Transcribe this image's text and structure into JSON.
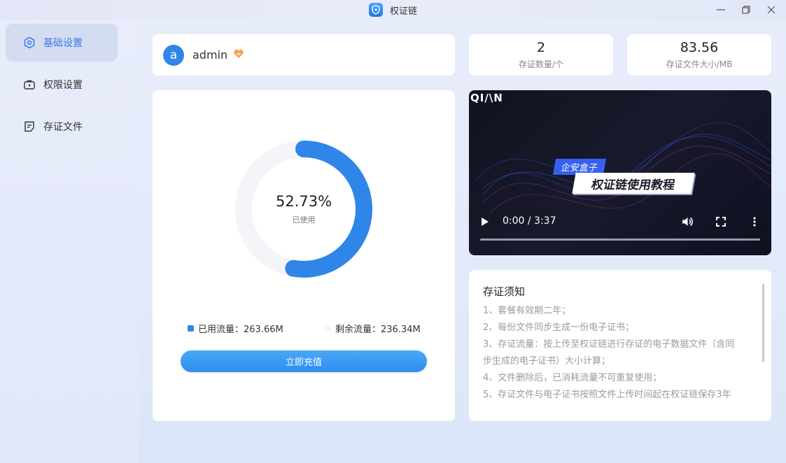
{
  "window": {
    "title": "权证链",
    "app_icon": "shield-app-icon",
    "controls": [
      "minimize-icon",
      "maximize-icon",
      "close-icon"
    ]
  },
  "sidebar": {
    "items": [
      {
        "label": "基础设置",
        "icon": "settings-hexagon-icon",
        "active": true
      },
      {
        "label": "权限设置",
        "icon": "briefcase-lock-icon",
        "active": false
      },
      {
        "label": "存证文件",
        "icon": "document-icon",
        "active": false
      }
    ]
  },
  "user": {
    "avatar_letter": "a",
    "name": "admin",
    "badge_icon": "heart-badge-icon"
  },
  "stats": [
    {
      "value": "2",
      "label": "存证数量/个"
    },
    {
      "value": "83.56",
      "label": "存证文件大小/MB"
    }
  ],
  "usage": {
    "percent_text": "52.73%",
    "percent": 52.73,
    "percent_label": "已使用",
    "used_label": "已用流量：263.66M",
    "remaining_label": "剩余流量：236.34M",
    "used_color": "#2f86e8",
    "remaining_color": "#f3f5f9",
    "button_label": "立即充值"
  },
  "video": {
    "brand": "QI/\\N",
    "tag": "企安盒子",
    "title": "权证链使用教程",
    "time": "0:00 / 3:37"
  },
  "notice": {
    "title": "存证须知",
    "items": [
      "1、套餐有效期二年；",
      "2、每份文件同步生成一份电子证书；",
      "3、存证流量：按上传至权证链进行存证的电子数据文件（含同",
      "步生成的电子证书）大小计算；",
      "4、文件删除后，已消耗流量不可重复使用；",
      "5、存证文件与电子证书按照文件上传时间起在权证链保存3年"
    ]
  }
}
